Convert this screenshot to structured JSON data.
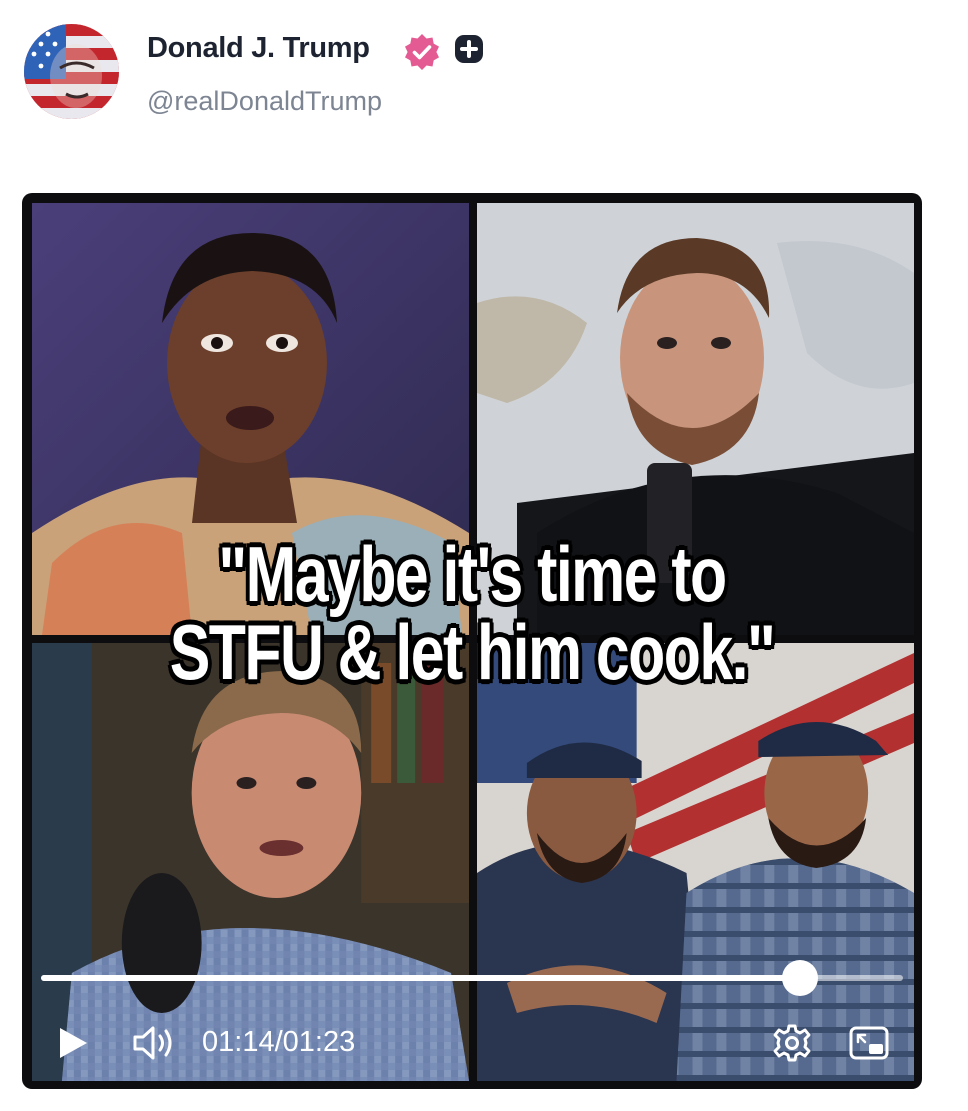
{
  "post": {
    "author_name": "Donald J. Trump",
    "author_handle": "@realDonaldTrump"
  },
  "icons": {
    "verified": "verified-badge-icon",
    "plus_badge": "plus-badge-icon",
    "play": "play-icon",
    "volume": "volume-icon",
    "settings": "gear-icon",
    "pip": "picture-in-picture-icon"
  },
  "colors": {
    "verified_badge": "#e45a92",
    "name_text": "#1d2330",
    "handle_text": "#7d8593",
    "video_frame": "#0d0d10"
  },
  "video": {
    "caption_line1": "\"Maybe it's time to",
    "caption_line2": "STFU & let him cook.\"",
    "current_time": "01:14",
    "duration": "01:23",
    "time_separator": "/",
    "progress_fraction": 0.88
  }
}
